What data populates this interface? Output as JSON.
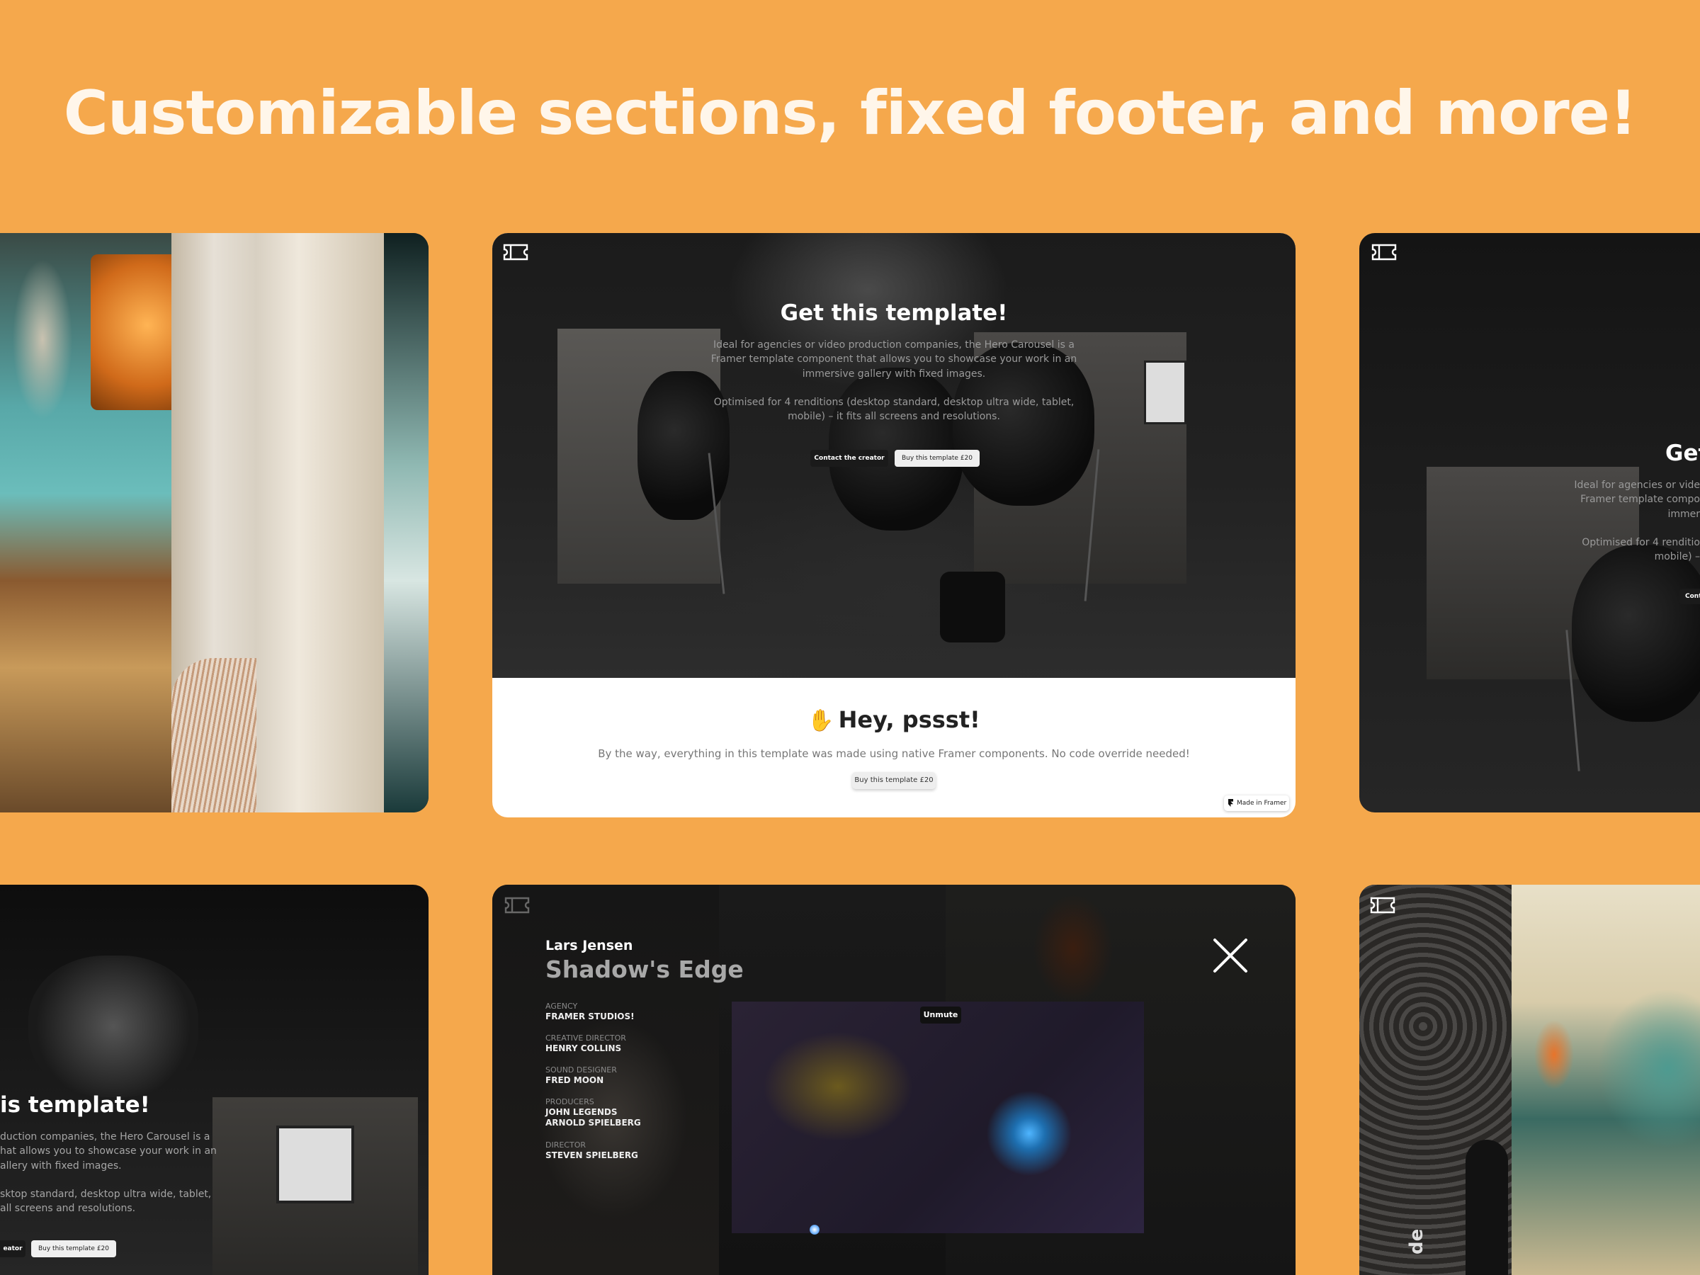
{
  "headline": "Customizable sections, fixed footer, and more!",
  "cards": {
    "top_center": {
      "title": "Get this template!",
      "paragraph_1_line_1": "Ideal for agencies or video production companies, the Hero Carousel is a",
      "paragraph_1_line_2": "Framer template component that allows you to showcase your work in an",
      "paragraph_1_line_3": "immersive gallery with fixed images.",
      "paragraph_2_line_1": "Optimised for 4 renditions (desktop standard, desktop ultra wide, tablet,",
      "paragraph_2_line_2": "mobile) – it fits all screens and resolutions.",
      "contact_label": "Contact the creator",
      "buy_label": "Buy this template £20",
      "psst_title": "Hey, pssst!",
      "psst_text": "By the way, everything in this template was made using native Framer components. No code override needed!",
      "psst_buy_label": "Buy this template £20",
      "badge_label": "Made in Framer"
    },
    "top_right": {
      "title": "Get",
      "line_1": "Ideal for agencies or vide",
      "line_2": "Framer template compo",
      "line_3": "immer",
      "line_4": "Optimised for 4 renditio",
      "line_5": "mobile) –",
      "button": "Cont"
    },
    "bottom_left": {
      "title": "is template!",
      "line_1": "duction companies, the Hero Carousel is a",
      "line_2": "hat allows you to showcase your work in an",
      "line_3": "allery with fixed images.",
      "line_4": "sktop standard, desktop ultra wide, tablet,",
      "line_5": "all screens and resolutions.",
      "contact_label": "eator",
      "buy_label": "Buy this template £20"
    },
    "bottom_center": {
      "artist": "Lars Jensen",
      "project": "Shadow's Edge",
      "credits": [
        {
          "label": "AGENCY",
          "value": "FRAMER STUDIOS!"
        },
        {
          "label": "CREATIVE DIRECTOR",
          "value": "HENRY COLLINS"
        },
        {
          "label": "SOUND DESIGNER",
          "value": "FRED MOON"
        },
        {
          "label": "PRODUCERS",
          "value": "JOHN LEGENDS",
          "value_2": "ARNOLD SPIELBERG"
        },
        {
          "label": "DIRECTOR",
          "value": "STEVEN SPIELBERG"
        }
      ],
      "unmute_label": "Unmute"
    },
    "bottom_right": {
      "vertical_text": "de"
    }
  },
  "colors": {
    "background": "#F5A84C",
    "headline": "#FFF6EA"
  }
}
